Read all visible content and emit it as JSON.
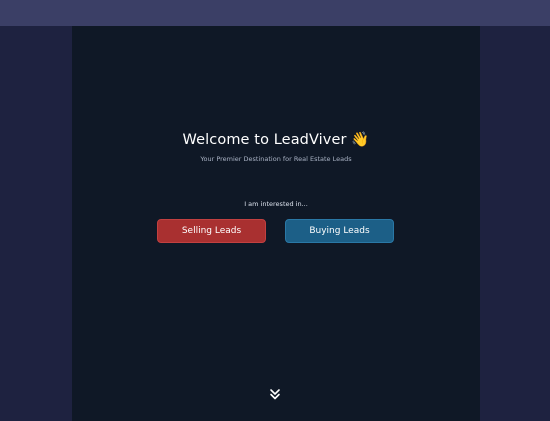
{
  "hero": {
    "title": "Welcome to LeadViver 👋",
    "subtitle": "Your Premier Destination for Real Estate Leads",
    "prompt": "I am interested in..."
  },
  "buttons": {
    "selling_label": "Selling Leads",
    "buying_label": "Buying Leads"
  },
  "icons": {
    "scroll": "double-chevron-down-icon"
  },
  "colors": {
    "top_bar": "#3b3f66",
    "side_background": "#1e2240",
    "main_background": "#0f1826",
    "selling_button": "#a93030",
    "buying_button": "#1c5f87"
  }
}
